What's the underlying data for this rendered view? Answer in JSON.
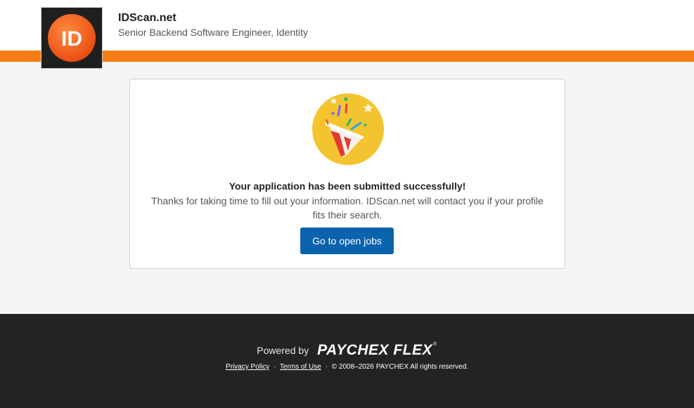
{
  "header": {
    "logo_text": "ID",
    "company": "IDScan.net",
    "job_title": "Senior Backend Software Engineer, Identity"
  },
  "card": {
    "illustration_icon": "party-popper-icon",
    "title": "Your application has been submitted successfully!",
    "message": "Thanks for taking time to fill out your information. IDScan.net will contact you if your profile fits their search.",
    "button_label": "Go to open jobs"
  },
  "footer": {
    "powered_by": "Powered by",
    "brand": "PAYCHEX FLEX",
    "brand_mark": "®",
    "privacy": "Privacy Policy",
    "separator": "·",
    "terms": "Terms of Use",
    "copyright": "© 2008–2026 PAYCHEX All rights reserved."
  },
  "colors": {
    "accent_orange": "#f57c14",
    "button_blue": "#0b63ad",
    "footer_bg": "#232323",
    "illustration_yellow": "#f4c430"
  }
}
